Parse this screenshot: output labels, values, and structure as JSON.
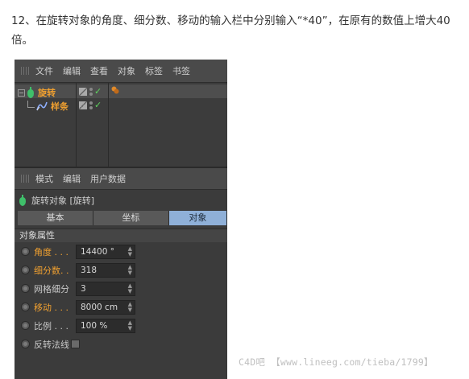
{
  "instruction": "12、在旋转对象的角度、细分数、移动的输入栏中分别输入“*40”，在原有的数值上增大40倍。",
  "menubar": {
    "items": [
      "文件",
      "编辑",
      "查看",
      "对象",
      "标签",
      "书签"
    ]
  },
  "objects": {
    "items": [
      {
        "name": "旋转",
        "icon": "lathe-icon",
        "tree": "minus"
      },
      {
        "name": "样条",
        "icon": "spline-icon",
        "tree": "child"
      }
    ],
    "tag_icon": "material-tag-icon"
  },
  "attributes": {
    "menu": [
      "模式",
      "编辑",
      "用户数据"
    ],
    "title": "旋转对象 [旋转]",
    "tabs": [
      "基本",
      "坐标",
      "对象"
    ],
    "active_tab": "对象",
    "section": "对象属性",
    "props": [
      {
        "label": "角度 . . .",
        "value": "14400 °",
        "highlight": true
      },
      {
        "label": "细分数. .",
        "value": "318",
        "highlight": true
      },
      {
        "label": "网格细分",
        "value": "3",
        "highlight": false
      },
      {
        "label": "移动 . . .",
        "value": "8000 cm",
        "highlight": true
      },
      {
        "label": "比例 . . .",
        "value": "100 %",
        "highlight": false
      },
      {
        "label": "反转法线",
        "value": "",
        "highlight": false,
        "checkbox": true
      }
    ]
  },
  "watermark": "C4D吧 【www.lineeg.com/tieba/1799】",
  "colors": {
    "accent": "#f0a030",
    "active_tab": "#8fb0d8",
    "check": "#5fd35f"
  }
}
